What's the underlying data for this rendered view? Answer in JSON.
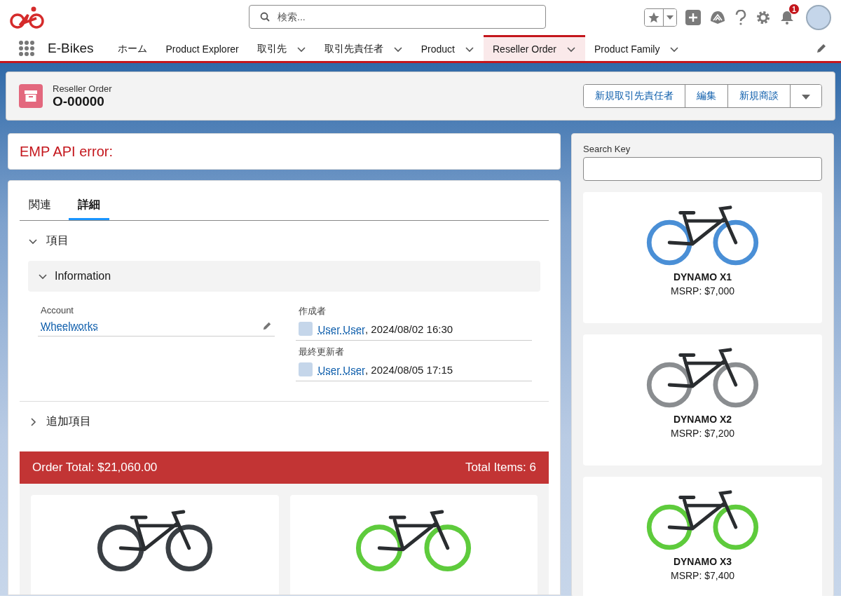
{
  "app": {
    "name": "E-Bikes"
  },
  "search": {
    "placeholder": "検索..."
  },
  "notifications": {
    "count": "1"
  },
  "nav_tabs": [
    {
      "label": "ホーム",
      "has_menu": false,
      "selected": false
    },
    {
      "label": "Product Explorer",
      "has_menu": false,
      "selected": false
    },
    {
      "label": "取引先",
      "has_menu": true,
      "selected": false
    },
    {
      "label": "取引先責任者",
      "has_menu": true,
      "selected": false
    },
    {
      "label": "Product",
      "has_menu": true,
      "selected": false
    },
    {
      "label": "Reseller Order",
      "has_menu": true,
      "selected": true
    },
    {
      "label": "Product Family",
      "has_menu": true,
      "selected": false
    }
  ],
  "record": {
    "object": "Reseller Order",
    "name": "O-00000",
    "actions": [
      "新規取引先責任者",
      "編集",
      "新規商談"
    ]
  },
  "error": {
    "message": "EMP API error:"
  },
  "detail_tabs": [
    {
      "label": "関連",
      "selected": false
    },
    {
      "label": "詳細",
      "selected": true
    }
  ],
  "sections": [
    {
      "kind": "group",
      "heading": "項目",
      "expanded": true
    },
    {
      "kind": "panel",
      "heading": "Information",
      "expanded": true
    },
    {
      "kind": "group",
      "heading": "追加項目",
      "expanded": false
    }
  ],
  "account": {
    "label": "Account",
    "value": "Wheelworks"
  },
  "audit": [
    {
      "label": "作成者",
      "user": "User User",
      "date": ", 2024/08/02 16:30"
    },
    {
      "label": "最終更新者",
      "user": "User User",
      "date": ", 2024/08/05 17:15"
    }
  ],
  "order": {
    "total": "Order Total: $21,060.00",
    "items": "Total Items: 6",
    "products": [
      {
        "color": "#3a3f44"
      },
      {
        "color": "#5ecb3c"
      }
    ]
  },
  "search_key": {
    "label": "Search Key"
  },
  "products": [
    {
      "name": "DYNAMO X1",
      "price": "MSRP: $7,000",
      "color": "#4a8fd6"
    },
    {
      "name": "DYNAMO X2",
      "price": "MSRP: $7,200",
      "color": "#8a8d90"
    },
    {
      "name": "DYNAMO X3",
      "price": "MSRP: $7,400",
      "color": "#5ecb3c"
    }
  ]
}
